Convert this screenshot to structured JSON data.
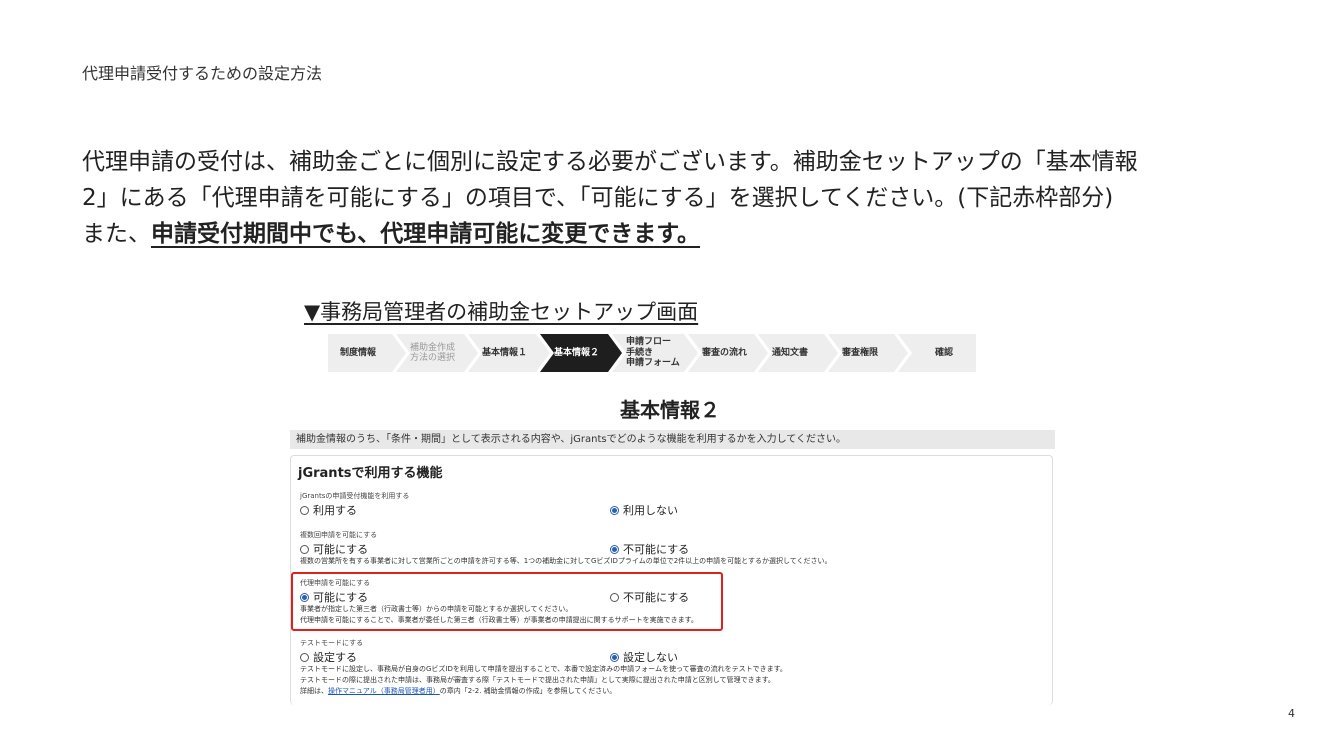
{
  "header": {
    "title": "代理申請受付するための設定方法"
  },
  "body": {
    "line1": "代理申請の受付は、補助金ごとに個別に設定する必要がございます。補助金セットアップの「基本情報",
    "line2": "2」にある「代理申請を可能にする」の項目で、「可能にする」を選択してください。(下記赤枠部分)",
    "line3_prefix": "また、",
    "line3_emphasis": "申請受付期間中でも、代理申請可能に変更できます。"
  },
  "caption": "▼事務局管理者の補助金セットアップ画面",
  "stepper": {
    "steps": [
      {
        "label": "制度情報"
      },
      {
        "label_line1": "補助金作成",
        "label_line2": "方法の選択"
      },
      {
        "label": "基本情報１"
      },
      {
        "label": "基本情報２"
      },
      {
        "label_line1": "申請フロー",
        "label_line2": "手続き",
        "label_line3": "申請フォーム"
      },
      {
        "label": "審査の流れ"
      },
      {
        "label": "通知文書"
      },
      {
        "label": "審査権限"
      },
      {
        "label": "確認"
      }
    ]
  },
  "section_title": "基本情報２",
  "info_bar": "補助金情報のうち、「条件・期間」として表示される内容や、jGrantsでどのような機能を利用するかを入力してください。",
  "form": {
    "card_title": "jGrantsで利用する機能",
    "questions": [
      {
        "label": "jGrantsの申請受付機能を利用する",
        "option_a": "利用する",
        "option_b": "利用しない",
        "selected": "b"
      },
      {
        "label": "複数回申請を可能にする",
        "option_a": "可能にする",
        "option_b": "不可能にする",
        "selected": "b",
        "desc1": "複数の営業所を有する事業者に対して営業所ごとの申請を許可する等、1つの補助金に対してGビズIDプライムの単位で2件以上の申請を可能とするか選択してください。"
      },
      {
        "label": "代理申請を可能にする",
        "option_a": "可能にする",
        "option_b": "不可能にする",
        "selected": "a",
        "desc1": "事業者が指定した第三者（行政書士等）からの申請を可能とするか選択してください。",
        "desc2": "代理申請を可能にすることで、事業者が委任した第三者（行政書士等）が事業者の申請提出に関するサポートを実施できます。"
      },
      {
        "label": "テストモードにする",
        "option_a": "設定する",
        "option_b": "設定しない",
        "selected": "b",
        "desc1": "テストモードに設定し、事務局が自身のGビズIDを利用して申請を提出することで、本番で設定済みの申請フォームを使って審査の流れをテストできます。",
        "desc2": "テストモードの際に提出された申請は、事務局が審査する際「テストモードで提出された申請」として実際に提出された申請と区別して管理できます。",
        "desc3_prefix": "詳細は、",
        "desc3_link": "操作マニュアル（事務局管理者用）",
        "desc3_suffix": "の章内「2-2. 補助金情報の作成」を参照してください。"
      }
    ]
  },
  "highlight_color": "#e0201b",
  "active_step_color": "#1e1e1e",
  "page_number": "4"
}
